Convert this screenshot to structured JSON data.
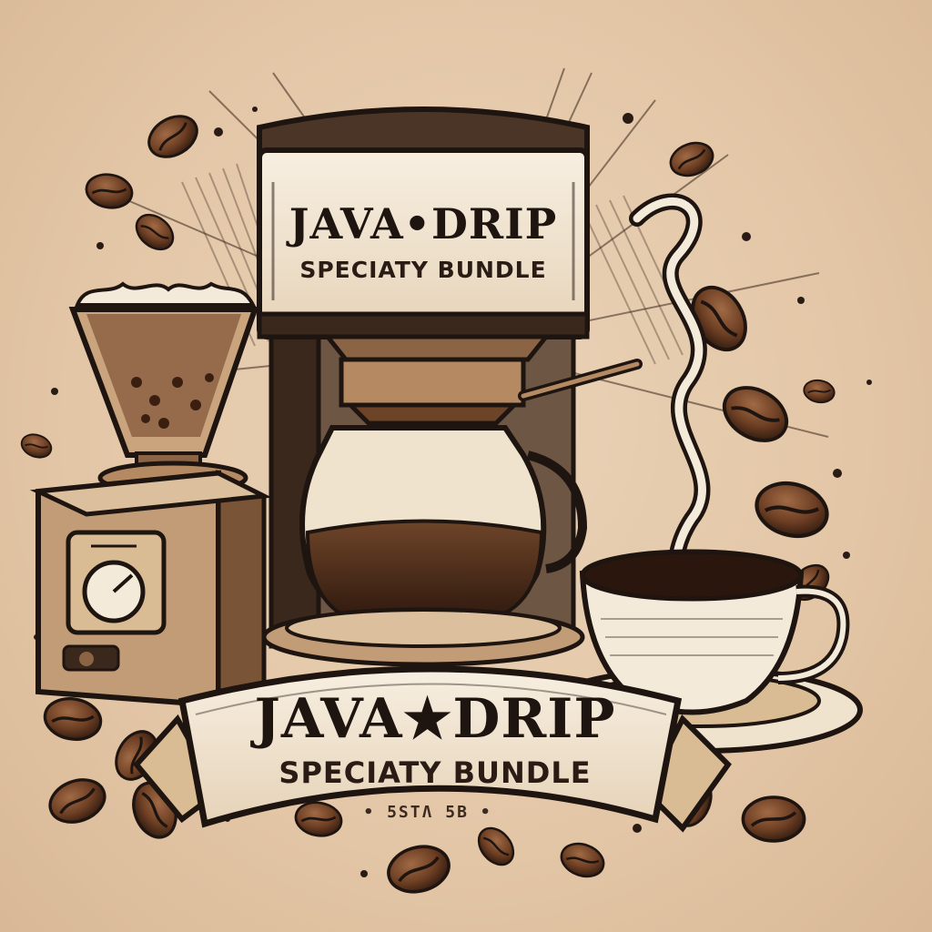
{
  "emblem": {
    "can_label": {
      "title": "JAVA•DRIP",
      "subtitle": "SPECIATY BUNDLE"
    },
    "banner": {
      "title": "JAVA★DRIP",
      "subtitle": "SPECIATY BUNDLE",
      "small_text": "• 5STɅ 5B •"
    }
  },
  "colors": {
    "background": "#e3c6a6",
    "ink": "#1e1410",
    "cream": "#f4ead9",
    "coffee": "#5a3420",
    "bean": "#6b3d22"
  }
}
